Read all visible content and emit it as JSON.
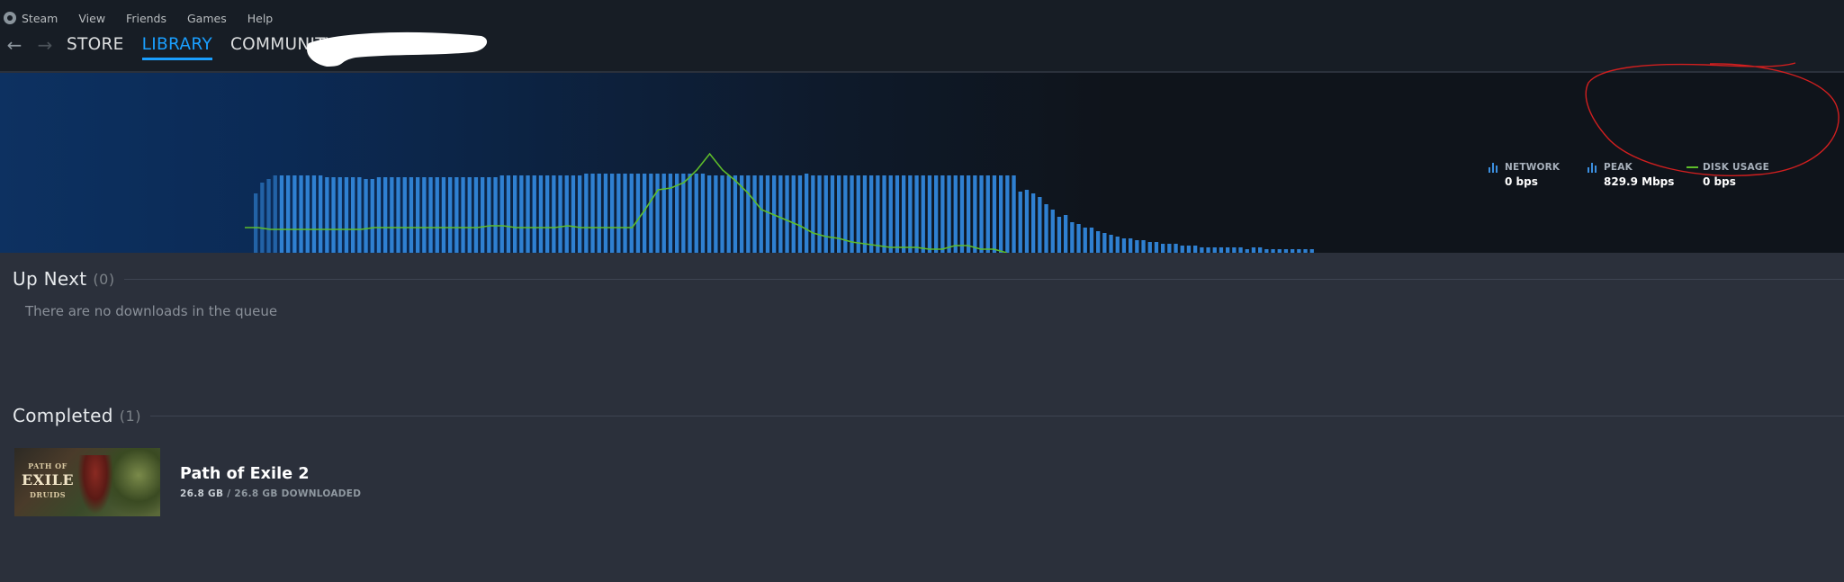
{
  "menu": {
    "items": [
      "Steam",
      "View",
      "Friends",
      "Games",
      "Help"
    ]
  },
  "nav": {
    "tabs": [
      {
        "label": "STORE",
        "active": false
      },
      {
        "label": "LIBRARY",
        "active": true
      },
      {
        "label": "COMMUNITY",
        "active": false
      }
    ]
  },
  "legend": {
    "network": {
      "name": "NETWORK",
      "value": "0 bps"
    },
    "peak": {
      "name": "PEAK",
      "value": "829.9 Mbps"
    },
    "disk": {
      "name": "DISK USAGE",
      "value": "0 bps"
    }
  },
  "colors": {
    "network_bars": "#2f80d1",
    "disk_line": "#5ebd2a",
    "accent": "#1a9fff",
    "annotation": "#d11f1f"
  },
  "chart_data": {
    "type": "bar",
    "series": [
      {
        "name": "NETWORK",
        "values": [
          0.33,
          0.39,
          0.41,
          0.43,
          0.43,
          0.43,
          0.43,
          0.43,
          0.43,
          0.43,
          0.43,
          0.42,
          0.42,
          0.42,
          0.42,
          0.42,
          0.42,
          0.41,
          0.41,
          0.42,
          0.42,
          0.42,
          0.42,
          0.42,
          0.42,
          0.42,
          0.42,
          0.42,
          0.42,
          0.42,
          0.42,
          0.42,
          0.42,
          0.42,
          0.42,
          0.42,
          0.42,
          0.42,
          0.43,
          0.43,
          0.43,
          0.43,
          0.43,
          0.43,
          0.43,
          0.43,
          0.43,
          0.43,
          0.43,
          0.43,
          0.43,
          0.44,
          0.44,
          0.44,
          0.44,
          0.44,
          0.44,
          0.44,
          0.44,
          0.44,
          0.44,
          0.44,
          0.44,
          0.44,
          0.44,
          0.44,
          0.44,
          0.44,
          0.44,
          0.44,
          0.43,
          0.43,
          0.43,
          0.43,
          0.43,
          0.43,
          0.43,
          0.43,
          0.43,
          0.43,
          0.43,
          0.43,
          0.43,
          0.43,
          0.43,
          0.44,
          0.43,
          0.43,
          0.43,
          0.43,
          0.43,
          0.43,
          0.43,
          0.43,
          0.43,
          0.43,
          0.43,
          0.43,
          0.43,
          0.43,
          0.43,
          0.43,
          0.43,
          0.43,
          0.43,
          0.43,
          0.43,
          0.43,
          0.43,
          0.43,
          0.43,
          0.43,
          0.43,
          0.43,
          0.43,
          0.43,
          0.43,
          0.43,
          0.34,
          0.35,
          0.33,
          0.31,
          0.27,
          0.24,
          0.2,
          0.21,
          0.17,
          0.16,
          0.14,
          0.14,
          0.12,
          0.11,
          0.1,
          0.09,
          0.08,
          0.08,
          0.07,
          0.07,
          0.06,
          0.06,
          0.05,
          0.05,
          0.05,
          0.04,
          0.04,
          0.04,
          0.03,
          0.03,
          0.03,
          0.03,
          0.03,
          0.03,
          0.03,
          0.02,
          0.03,
          0.03,
          0.02,
          0.02,
          0.02,
          0.02,
          0.02,
          0.02,
          0.02,
          0.02
        ]
      },
      {
        "name": "DISK USAGE",
        "values": [
          0.14,
          0.14,
          0.13,
          0.13,
          0.13,
          0.13,
          0.13,
          0.13,
          0.13,
          0.13,
          0.14,
          0.14,
          0.14,
          0.14,
          0.14,
          0.14,
          0.14,
          0.14,
          0.14,
          0.15,
          0.15,
          0.14,
          0.14,
          0.14,
          0.14,
          0.15,
          0.14,
          0.14,
          0.14,
          0.14,
          0.14,
          0.24,
          0.35,
          0.36,
          0.39,
          0.46,
          0.55,
          0.46,
          0.4,
          0.33,
          0.24,
          0.21,
          0.18,
          0.15,
          0.11,
          0.09,
          0.08,
          0.06,
          0.05,
          0.04,
          0.03,
          0.03,
          0.03,
          0.02,
          0.02,
          0.04,
          0.04,
          0.02,
          0.02,
          0.0
        ]
      }
    ],
    "ylim": [
      0,
      1
    ],
    "legend_position": "top-right",
    "grid": false
  },
  "queue": {
    "up_next": {
      "title": "Up Next",
      "count": "(0)",
      "empty_message": "There are no downloads in the queue"
    },
    "completed": {
      "title": "Completed",
      "count": "(1)"
    }
  },
  "completed_items": [
    {
      "name": "Path of Exile 2",
      "cover_logo_top": "PATH OF",
      "cover_logo_main": "EXILE",
      "cover_logo_sub": "DRUIDS",
      "downloaded": "26.8 GB",
      "total": "/ 26.8 GB DOWNLOADED"
    }
  ]
}
